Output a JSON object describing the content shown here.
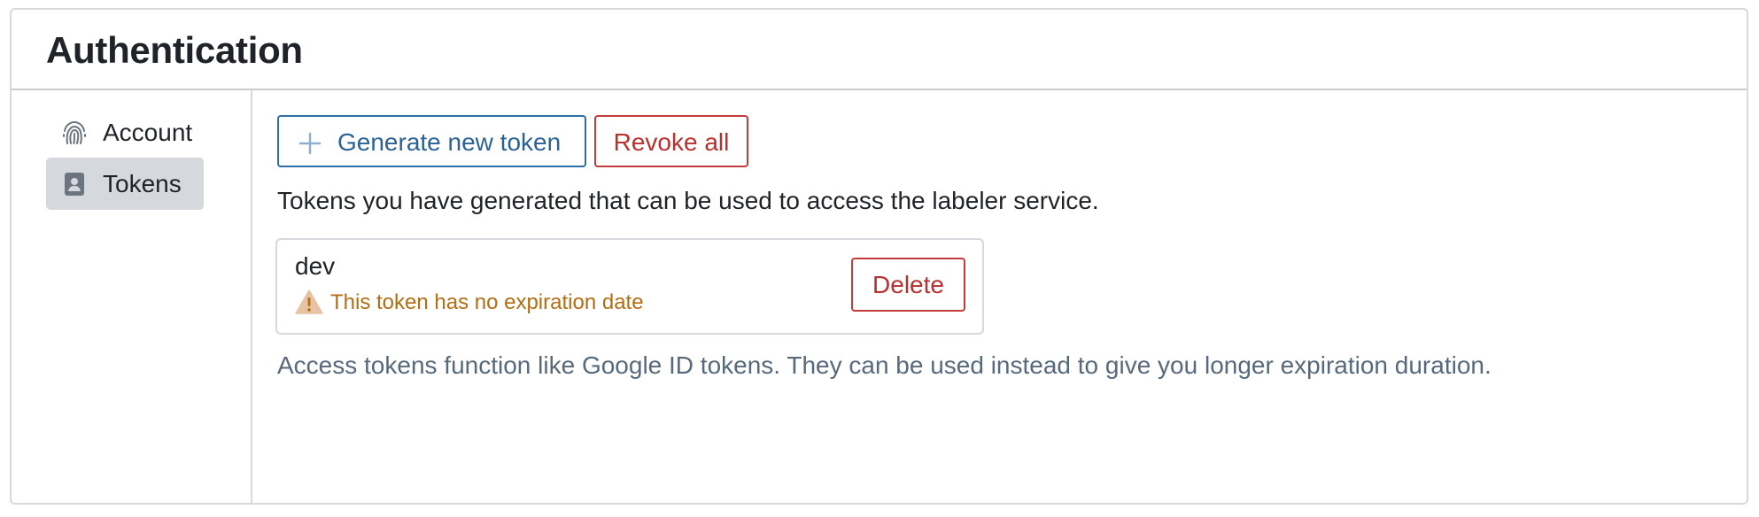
{
  "header": {
    "title": "Authentication"
  },
  "sidebar": {
    "items": [
      {
        "label": "Account",
        "icon": "fingerprint-icon",
        "active": false
      },
      {
        "label": "Tokens",
        "icon": "id-badge-icon",
        "active": true
      }
    ]
  },
  "toolbar": {
    "generate_label": "Generate new token",
    "generate_icon": "plus-icon",
    "revoke_label": "Revoke all"
  },
  "main": {
    "description": "Tokens you have generated that can be used to access the labeler service.",
    "tokens": [
      {
        "name": "dev",
        "warning": "This token has no expiration date",
        "warning_icon": "warning-triangle-icon",
        "delete_label": "Delete"
      }
    ],
    "footnote": "Access tokens function like Google ID tokens. They can be used instead to give you longer expiration duration."
  },
  "colors": {
    "primary": "#2b6296",
    "danger": "#b8312f",
    "warning": "#b46d12",
    "muted": "#57697c",
    "active_bg": "#d5d9de"
  }
}
